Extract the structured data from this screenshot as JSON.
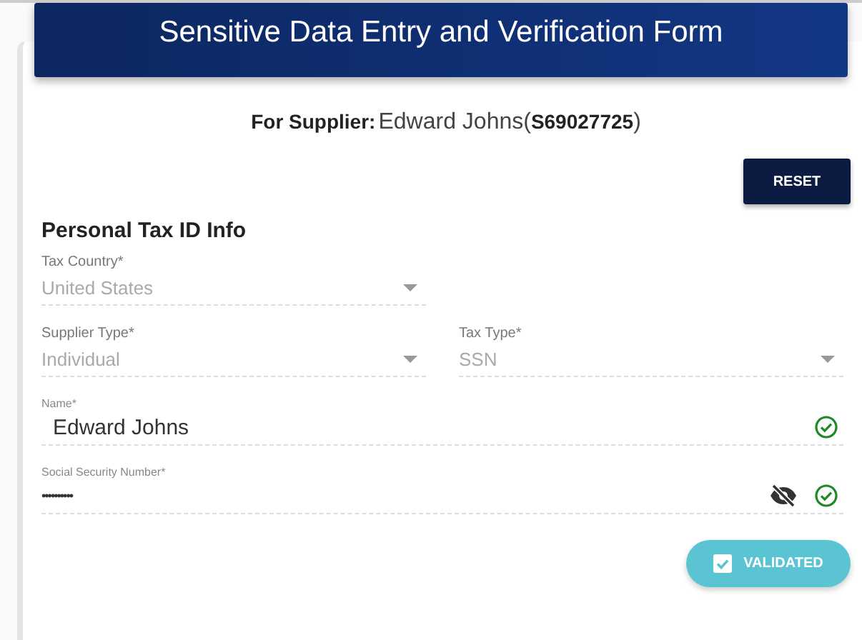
{
  "header": {
    "title": "Sensitive Data Entry and Verification Form"
  },
  "supplier": {
    "label": "For Supplier:",
    "name": "Edward Johns",
    "code_open": "(",
    "code": "S69027725",
    "code_close": ")"
  },
  "reset_button": {
    "label": "RESET"
  },
  "section": {
    "title": "Personal Tax ID Info"
  },
  "rows": [
    [
      {
        "kind": "select",
        "label": "Tax Country*",
        "value": "United States",
        "disabled": true
      }
    ],
    [
      {
        "kind": "select",
        "label": "Supplier Type*",
        "value": "Individual",
        "disabled": true
      },
      {
        "kind": "select",
        "label": "Tax Type*",
        "value": "SSN",
        "disabled": true
      }
    ],
    [
      {
        "kind": "text",
        "label": "Name*",
        "value": "Edward Johns",
        "valid": true
      }
    ],
    [
      {
        "kind": "password",
        "label": "Social Security Number*",
        "value": "••••••••••",
        "masked": true,
        "valid": true
      }
    ]
  ],
  "validate_button": {
    "label": "VALIDATED",
    "checked": true
  }
}
